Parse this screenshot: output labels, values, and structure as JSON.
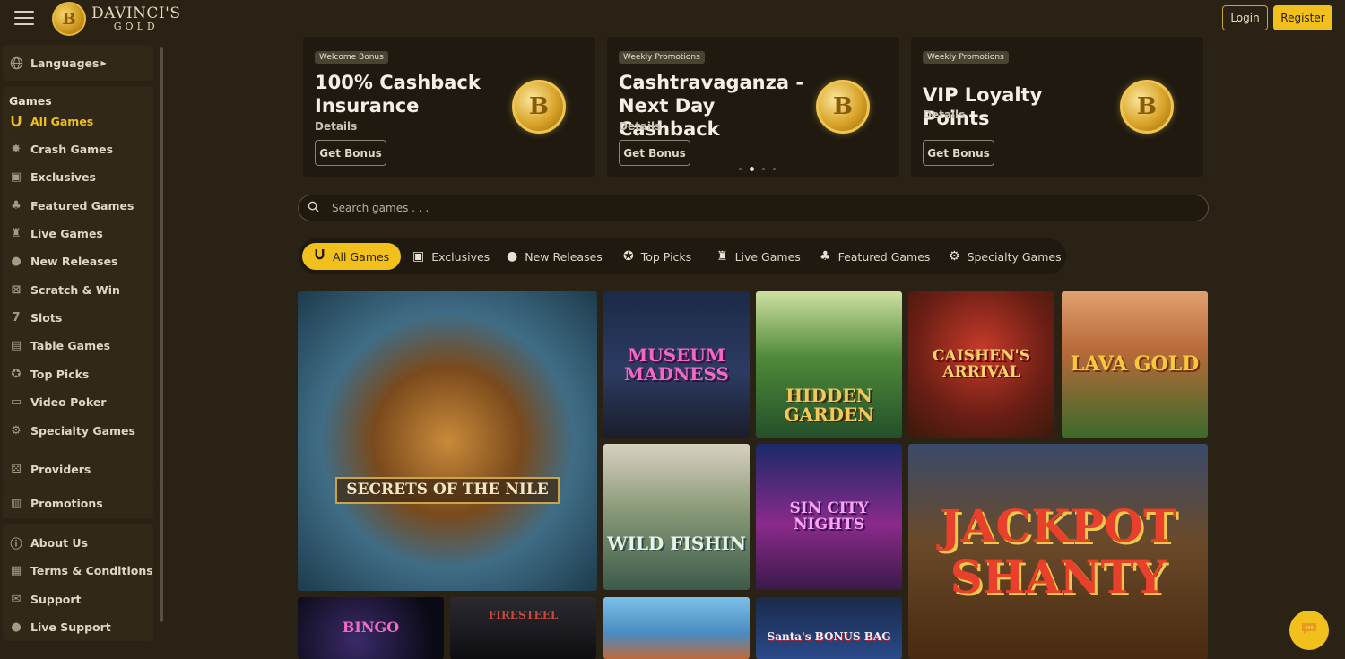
{
  "header": {
    "logo_line1": "DAVINCI'S",
    "logo_line2": "GOLD",
    "logo_coin_letter": "B",
    "login": "Login",
    "register": "Register"
  },
  "sidebar": {
    "languages": "Languages",
    "games_heading": "Games",
    "games": [
      {
        "label": "All Games",
        "icon": "horseshoe-icon"
      },
      {
        "label": "Crash Games",
        "icon": "crash-icon"
      },
      {
        "label": "Exclusives",
        "icon": "exclusives-icon"
      },
      {
        "label": "Featured Games",
        "icon": "clover-icon"
      },
      {
        "label": "Live Games",
        "icon": "live-icon"
      },
      {
        "label": "New Releases",
        "icon": "new-icon"
      },
      {
        "label": "Scratch & Win",
        "icon": "scratch-icon"
      },
      {
        "label": "Slots",
        "icon": "slots-icon"
      },
      {
        "label": "Table Games",
        "icon": "table-icon"
      },
      {
        "label": "Top Picks",
        "icon": "award-icon"
      },
      {
        "label": "Video Poker",
        "icon": "video-poker-icon"
      },
      {
        "label": "Specialty Games",
        "icon": "gear-icon"
      }
    ],
    "providers": "Providers",
    "promotions": "Promotions",
    "info": [
      {
        "label": "About Us",
        "icon": "info-icon"
      },
      {
        "label": "Terms & Conditions",
        "icon": "document-icon"
      },
      {
        "label": "Support",
        "icon": "mail-icon"
      },
      {
        "label": "Live Support",
        "icon": "chat-icon"
      }
    ]
  },
  "promos": [
    {
      "tag": "Welcome Bonus",
      "title": "100% Cashback Insurance",
      "details": "Details",
      "button": "Get Bonus"
    },
    {
      "tag": "Weekly Promotions",
      "title": "Cashtravaganza - Next Day Cashback",
      "details": "Details",
      "button": "Get Bonus"
    },
    {
      "tag": "Weekly Promotions",
      "title": "VIP Loyalty Points",
      "details": "Details",
      "button": "Get Bonus"
    }
  ],
  "search": {
    "placeholder": "Search games . . ."
  },
  "tabs": [
    "All Games",
    "Exclusives",
    "New Releases",
    "Top Picks",
    "Live Games",
    "Featured Games",
    "Specialty Games"
  ],
  "games": [
    {
      "title": "SECRETS OF THE NILE"
    },
    {
      "title": "MUSEUM MADNESS"
    },
    {
      "title": "HIDDEN GARDEN"
    },
    {
      "title": "CAISHEN'S ARRIVAL"
    },
    {
      "title": "LAVA GOLD"
    },
    {
      "title": "WILD FISHIN"
    },
    {
      "title": "SIN CITY NIGHTS"
    },
    {
      "title": "JACKPOT SHANTY"
    },
    {
      "title": "BINGO"
    },
    {
      "title": "FIRESTEEL"
    },
    {
      "title": ""
    },
    {
      "title": "Santa's BONUS BAG"
    }
  ],
  "colors": {
    "accent": "#f2c01c",
    "background": "#2a2214",
    "panel": "#1f190f"
  }
}
